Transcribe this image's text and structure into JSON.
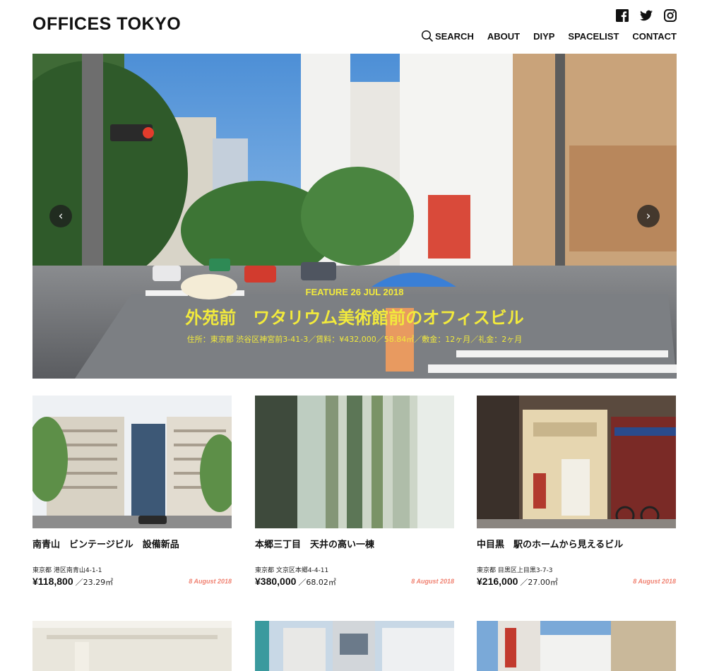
{
  "header": {
    "logo": "OFFICES TOKYO",
    "social": [
      {
        "icon": "facebook-icon"
      },
      {
        "icon": "twitter-icon"
      },
      {
        "icon": "instagram-icon"
      }
    ],
    "nav": [
      {
        "label": "SEARCH",
        "icon": "search-icon"
      },
      {
        "label": "ABOUT"
      },
      {
        "label": "DIYP"
      },
      {
        "label": "SPACELIST"
      },
      {
        "label": "CONTACT"
      }
    ]
  },
  "hero": {
    "feature": "FEATURE 26 JUL 2018",
    "title": "外苑前　ワタリウム美術館前のオフィスビル",
    "meta": "住所：東京都 渋谷区神宮前3-41-3／賃料：¥432,000／58.84㎡／敷金：12ヶ月／礼金：2ヶ月",
    "prev_icon": "chevron-left-icon",
    "next_icon": "chevron-right-icon",
    "text_color": "#f2ea3c"
  },
  "listings": [
    {
      "title": "南青山　ビンテージビル　設備新品",
      "address": "東京都 港区南青山4-1-1",
      "price": "¥118,800",
      "area": "／23.29㎡",
      "date": "8 August 2018"
    },
    {
      "title": "本郷三丁目　天井の高い一棟",
      "address": "東京都 文京区本郷4-4-11",
      "price": "¥380,000",
      "area": "／68.02㎡",
      "date": "8 August 2018"
    },
    {
      "title": "中目黒　駅のホームから見えるビル",
      "address": "東京都 目黒区上目黒3-7-3",
      "price": "¥216,000",
      "area": "／27.00㎡",
      "date": "8 August 2018"
    }
  ],
  "colors": {
    "date": "#f08070",
    "accent": "#f2ea3c"
  }
}
